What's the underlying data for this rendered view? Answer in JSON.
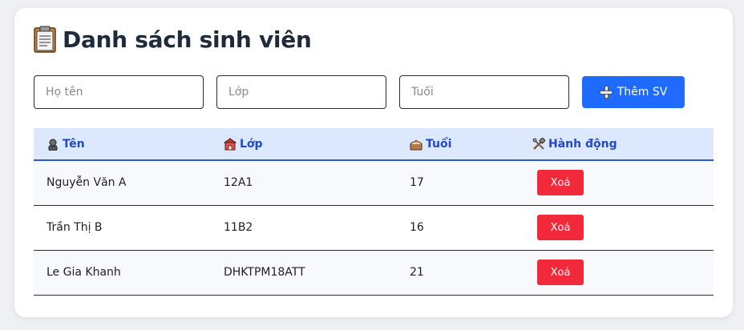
{
  "header": {
    "icon": "clipboard-icon",
    "title": "Danh sách sinh viên"
  },
  "form": {
    "name_placeholder": "Họ tên",
    "class_placeholder": "Lớp",
    "age_placeholder": "Tuổi",
    "add_icon": "plus-icon",
    "add_label": "Thêm SV"
  },
  "table": {
    "columns": [
      {
        "icon": "student-icon",
        "label": "Tên"
      },
      {
        "icon": "school-icon",
        "label": "Lớp"
      },
      {
        "icon": "cake-icon",
        "label": "Tuổi"
      },
      {
        "icon": "tools-icon",
        "label": "Hành động"
      }
    ],
    "rows": [
      {
        "name": "Nguyễn Văn A",
        "class": "12A1",
        "age": "17",
        "action": "Xoá"
      },
      {
        "name": "Trần Thị B",
        "class": "11B2",
        "age": "16",
        "action": "Xoá"
      },
      {
        "name": "Le Gia Khanh",
        "class": "DHKTPM18ATT",
        "age": "21",
        "action": "Xoá"
      }
    ]
  },
  "colors": {
    "accent": "#1f6bff",
    "header_bg": "#dbe8fd",
    "header_text": "#2249c9",
    "delete": "#f2293b"
  }
}
